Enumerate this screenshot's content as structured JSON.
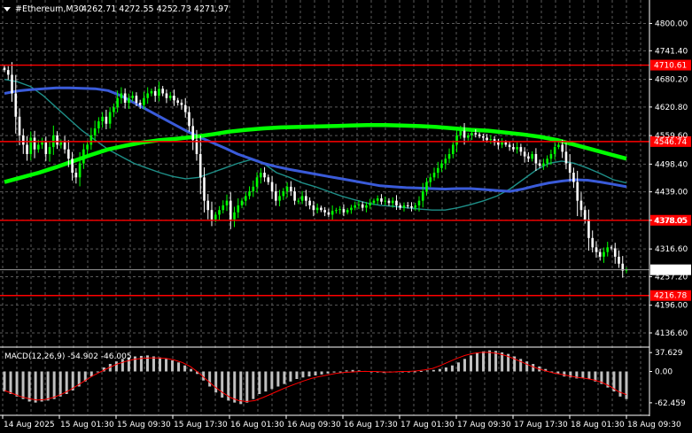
{
  "header": {
    "symbol": "#Ethereum,M30",
    "ohlc": "4262.71 4272.55 4252.73 4271.97"
  },
  "colors": {
    "background": "#000000",
    "grid": "#5a5a5a",
    "bull": "#00ff00",
    "bear": "#ffffff",
    "level": "#ff0000",
    "ma_fast": "#1e8f88",
    "ma_mid": "#3a5bd9",
    "ma_slow": "#00ff00",
    "macd_hist": "#c0c0c0",
    "macd_signal": "#ff0000"
  },
  "chart_data": {
    "type": "candlestick",
    "price_axis": {
      "range": [
        4110,
        4835
      ],
      "ticks": [
        "4800.00",
        "4741.40",
        "4680.20",
        "4620.80",
        "4559.60",
        "4498.40",
        "4439.00",
        "4378.05",
        "4316.60",
        "4257.20",
        "4196.00",
        "4136.60"
      ],
      "tick_values": [
        4800,
        4741.4,
        4680.2,
        4620.8,
        4559.6,
        4498.4,
        4439,
        4378.05,
        4316.6,
        4257.2,
        4196,
        4136.6
      ]
    },
    "time_axis": {
      "labels": [
        "14 Aug 2025",
        "15 Aug 01:30",
        "15 Aug 09:30",
        "15 Aug 17:30",
        "16 Aug 01:30",
        "16 Aug 09:30",
        "16 Aug 17:30",
        "17 Aug 01:30",
        "17 Aug 09:30",
        "17 Aug 17:30",
        "18 Aug 01:30",
        "18 Aug 09:30"
      ]
    },
    "levels": [
      {
        "label": "4710.61",
        "value": 4710.61
      },
      {
        "label": "4546.74",
        "value": 4546.74
      },
      {
        "label": "4378.05",
        "value": 4378.05
      },
      {
        "label": "4216.78",
        "value": 4216.78
      }
    ],
    "current_price": {
      "label": "4271.97",
      "value": 4271.97
    },
    "closes": [
      4700,
      4690,
      4650,
      4600,
      4560,
      4540,
      4520,
      4555,
      4530,
      4540,
      4545,
      4520,
      4535,
      4560,
      4540,
      4545,
      4530,
      4510,
      4480,
      4470,
      4500,
      4530,
      4540,
      4560,
      4575,
      4590,
      4600,
      4585,
      4610,
      4620,
      4640,
      4650,
      4630,
      4640,
      4645,
      4630,
      4625,
      4640,
      4650,
      4655,
      4645,
      4660,
      4650,
      4640,
      4645,
      4635,
      4630,
      4625,
      4610,
      4580,
      4550,
      4520,
      4470,
      4420,
      4400,
      4380,
      4390,
      4400,
      4410,
      4420,
      4380,
      4395,
      4410,
      4420,
      4430,
      4440,
      4450,
      4470,
      4480,
      4470,
      4460,
      4440,
      4420,
      4430,
      4440,
      4450,
      4440,
      4420,
      4420,
      4430,
      4420,
      4410,
      4400,
      4405,
      4400,
      4395,
      4390,
      4398,
      4400,
      4402,
      4395,
      4400,
      4405,
      4410,
      4412,
      4405,
      4410,
      4415,
      4420,
      4425,
      4418,
      4420,
      4415,
      4420,
      4410,
      4405,
      4410,
      4408,
      4405,
      4410,
      4420,
      4440,
      4460,
      4470,
      4480,
      4490,
      4500,
      4510,
      4520,
      4540,
      4560,
      4570,
      4555,
      4560,
      4565,
      4562,
      4558,
      4555,
      4550,
      4552,
      4545,
      4540,
      4545,
      4540,
      4535,
      4530,
      4535,
      4525,
      4515,
      4510,
      4520,
      4500,
      4495,
      4500,
      4510,
      4520,
      4535,
      4540,
      4525,
      4500,
      4480,
      4460,
      4420,
      4400,
      4380,
      4340,
      4320,
      4310,
      4300,
      4310,
      4320,
      4318,
      4300,
      4285,
      4270,
      4272
    ],
    "moving_averages": [
      {
        "values": [
          4680,
          4675,
          4665,
          4645,
          4620,
          4595,
          4570,
          4550,
          4530,
          4515,
          4500,
          4490,
          4480,
          4472,
          4467,
          4470,
          4480,
          4490,
          4500,
          4508,
          4500,
          4480,
          4470,
          4458,
          4450,
          4440,
          4430,
          4422,
          4415,
          4410,
          4408,
          4405,
          4402,
          4400,
          4400,
          4405,
          4412,
          4420,
          4430,
          4445,
          4465,
          4485,
          4500,
          4505,
          4500,
          4490,
          4478,
          4465,
          4458
        ]
      },
      {
        "values": [
          4650,
          4655,
          4658,
          4660,
          4662,
          4662,
          4661,
          4660,
          4656,
          4645,
          4630,
          4615,
          4600,
          4585,
          4570,
          4557,
          4545,
          4533,
          4520,
          4510,
          4500,
          4493,
          4487,
          4482,
          4477,
          4472,
          4467,
          4462,
          4457,
          4452,
          4450,
          4448,
          4447,
          4446,
          4445,
          4446,
          4446,
          4444,
          4442,
          4440,
          4445,
          4452,
          4458,
          4462,
          4465,
          4464,
          4460,
          4455,
          4450
        ]
      },
      {
        "values": [
          4460,
          4470,
          4480,
          4492,
          4505,
          4518,
          4530,
          4538,
          4545,
          4550,
          4553,
          4557,
          4562,
          4568,
          4572,
          4575,
          4577,
          4578,
          4579,
          4580,
          4581,
          4582,
          4582,
          4581,
          4580,
          4578,
          4575,
          4572,
          4570,
          4566,
          4562,
          4557,
          4550,
          4540,
          4530,
          4520,
          4510
        ]
      }
    ],
    "macd": {
      "label": "MACD(12,26,9) -54.902 -46.005",
      "ticks": [
        "37.629",
        "0.00",
        "-62.459"
      ],
      "tick_values": [
        37.629,
        0,
        -62.459
      ],
      "range": [
        -75,
        45
      ],
      "hist": [
        -40,
        -45,
        -50,
        -55,
        -60,
        -62,
        -60,
        -58,
        -55,
        -50,
        -45,
        -38,
        -30,
        -20,
        -10,
        0,
        8,
        15,
        20,
        25,
        28,
        30,
        31,
        32,
        30,
        28,
        25,
        22,
        18,
        12,
        5,
        -5,
        -18,
        -30,
        -42,
        -52,
        -58,
        -62,
        -65,
        -62,
        -55,
        -45,
        -40,
        -35,
        -30,
        -25,
        -20,
        -15,
        -12,
        -10,
        -8,
        -6,
        -4,
        -2,
        0,
        2,
        3,
        2,
        1,
        0,
        -2,
        -3,
        -2,
        -1,
        0,
        -1,
        0,
        1,
        2,
        3,
        5,
        8,
        12,
        18,
        25,
        32,
        38,
        40,
        42,
        41,
        38,
        35,
        30,
        25,
        20,
        15,
        10,
        5,
        0,
        -5,
        -10,
        -12,
        -14,
        -13,
        -15,
        -20,
        -25,
        -32,
        -40,
        -50,
        -55
      ],
      "signal": [
        -38,
        -44,
        -50,
        -54,
        -57,
        -56,
        -52,
        -46,
        -38,
        -28,
        -18,
        -8,
        0,
        8,
        15,
        20,
        24,
        26,
        27,
        27,
        26,
        23,
        18,
        10,
        -2,
        -16,
        -30,
        -42,
        -52,
        -58,
        -60,
        -58,
        -52,
        -45,
        -38,
        -31,
        -25,
        -19,
        -14,
        -10,
        -7,
        -4,
        -2,
        -1,
        0,
        0,
        0,
        -1,
        -1,
        0,
        0,
        1,
        3,
        6,
        12,
        19,
        26,
        32,
        36,
        38,
        38,
        36,
        32,
        26,
        19,
        12,
        6,
        1,
        -3,
        -6,
        -9,
        -12,
        -14,
        -17,
        -22,
        -30,
        -40,
        -46
      ]
    }
  }
}
